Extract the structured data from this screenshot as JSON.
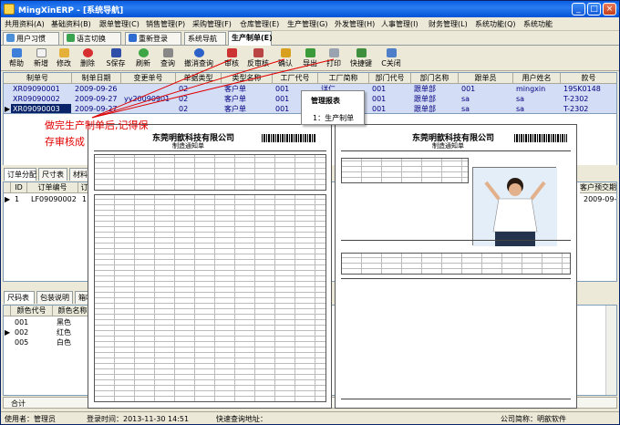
{
  "window": {
    "title": "MingXinERP - [系统导航]"
  },
  "menu": [
    "共用资料(A)",
    "基础资料(B)",
    "跟单管理(C)",
    "销售管理(P)",
    "采购管理(F)",
    "仓库管理(E)",
    "生产管理(G)",
    "外发管理(H)",
    "人事管理(I)",
    "财务管理(L)",
    "系统功能(Q)",
    "系统功能"
  ],
  "tabs": [
    "用户习惯",
    "语言切换",
    "重新登录",
    "系统导航",
    "生产制单(E)"
  ],
  "toolbar": [
    "帮助",
    "新增",
    "修改",
    "删除",
    "S保存",
    "刷新",
    "查询",
    "撤消查询",
    "审核",
    "反审核",
    "确认",
    "导出",
    "打印",
    "快捷键",
    "C关闭"
  ],
  "main_grid": {
    "headers": [
      "制单号",
      "制单日期",
      "变更单号",
      "单据类型",
      "类型名称",
      "工厂代号",
      "工厂简称",
      "部门代号",
      "部门名称",
      "跟单员",
      "用户姓名",
      "款号"
    ],
    "rows": [
      [
        "XR09090001",
        "2009-09-26",
        "",
        "02",
        "客户单",
        "001",
        "详仁",
        "001",
        "跟单部",
        "001",
        "mingxin",
        "19SK0148"
      ],
      [
        "XR09090002",
        "2009-09-27",
        "yy20090901",
        "02",
        "客户单",
        "001",
        "",
        "001",
        "跟单部",
        "sa",
        "sa",
        "T-2302"
      ],
      [
        "XR09090003",
        "2009-09-27",
        "",
        "02",
        "客户单",
        "001",
        "",
        "001",
        "跟单部",
        "sa",
        "sa",
        "T-2302"
      ]
    ]
  },
  "popup": {
    "header": "管理报表",
    "item": "1：生产制单"
  },
  "annotation": {
    "line1": "做完生产制单后,记得保",
    "line2": "存审核成"
  },
  "mid_tabs": [
    "订单分配",
    "尺寸表",
    "材料"
  ],
  "mid_grid": {
    "headers": [
      "ID",
      "订单编号",
      "订"
    ],
    "row": [
      "1",
      "LF09090002",
      "1"
    ],
    "right_header": "客户预交期",
    "right_value": "2009-09-27"
  },
  "lower_tabs": [
    "尺码表",
    "包装说明",
    "箱唛"
  ],
  "lower_grid": {
    "headers": [
      "颜色代号",
      "颜色名称"
    ],
    "rows": [
      [
        "001",
        "黑色"
      ],
      [
        "002",
        "红色"
      ],
      [
        "005",
        "白色"
      ]
    ]
  },
  "totals": {
    "label": "合计",
    "values": [
      "210",
      "210",
      "210",
      "210",
      "210",
      "1050"
    ]
  },
  "doc_left": {
    "company": "东莞明歆科技有限公司",
    "subtitle": "制造通知单"
  },
  "doc_right": {
    "company": "东莞明歆科技有限公司",
    "subtitle": "制造通知单"
  },
  "status": {
    "user": "使用者：管理员",
    "login": "登录时间：2013-11-30 14:51",
    "quick": "快速查询地址：",
    "company": "公司简称：明歆软件"
  },
  "colors": {
    "title_blue": "#0a5ee3",
    "selection": "#0a246a",
    "annotation_red": "#e00000"
  }
}
